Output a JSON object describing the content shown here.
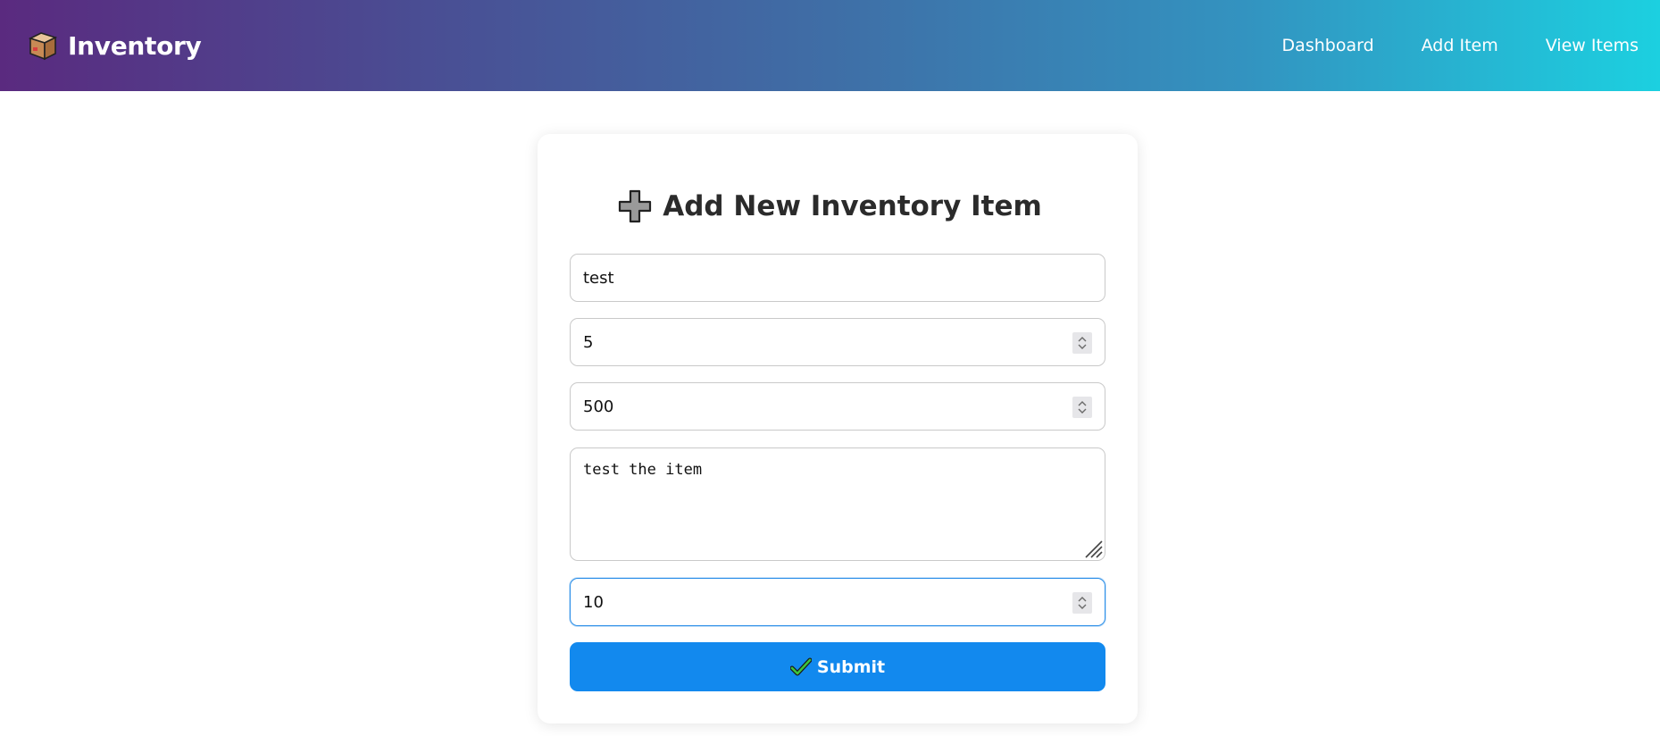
{
  "navbar": {
    "brand_icon": "package-box-icon",
    "brand_text": "Inventory",
    "links": [
      {
        "label": "Dashboard"
      },
      {
        "label": "Add Item"
      },
      {
        "label": "View Items"
      }
    ]
  },
  "form": {
    "title_icon": "plus-icon",
    "title": "Add New Inventory Item",
    "fields": [
      {
        "name": "item-name",
        "type": "text",
        "value": "test"
      },
      {
        "name": "quantity",
        "type": "number",
        "value": "5"
      },
      {
        "name": "price",
        "type": "number",
        "value": "500"
      },
      {
        "name": "description",
        "type": "textarea",
        "value": "test the item"
      },
      {
        "name": "reorder-level",
        "type": "number",
        "value": "10"
      }
    ],
    "submit_icon": "checkmark-icon",
    "submit_label": "Submit"
  },
  "colors": {
    "submit_button": "#1289ee",
    "focus_border": "#2a8ee8",
    "navbar_gradient_start": "#5a2a7f",
    "navbar_gradient_end": "#1cd0e0"
  }
}
